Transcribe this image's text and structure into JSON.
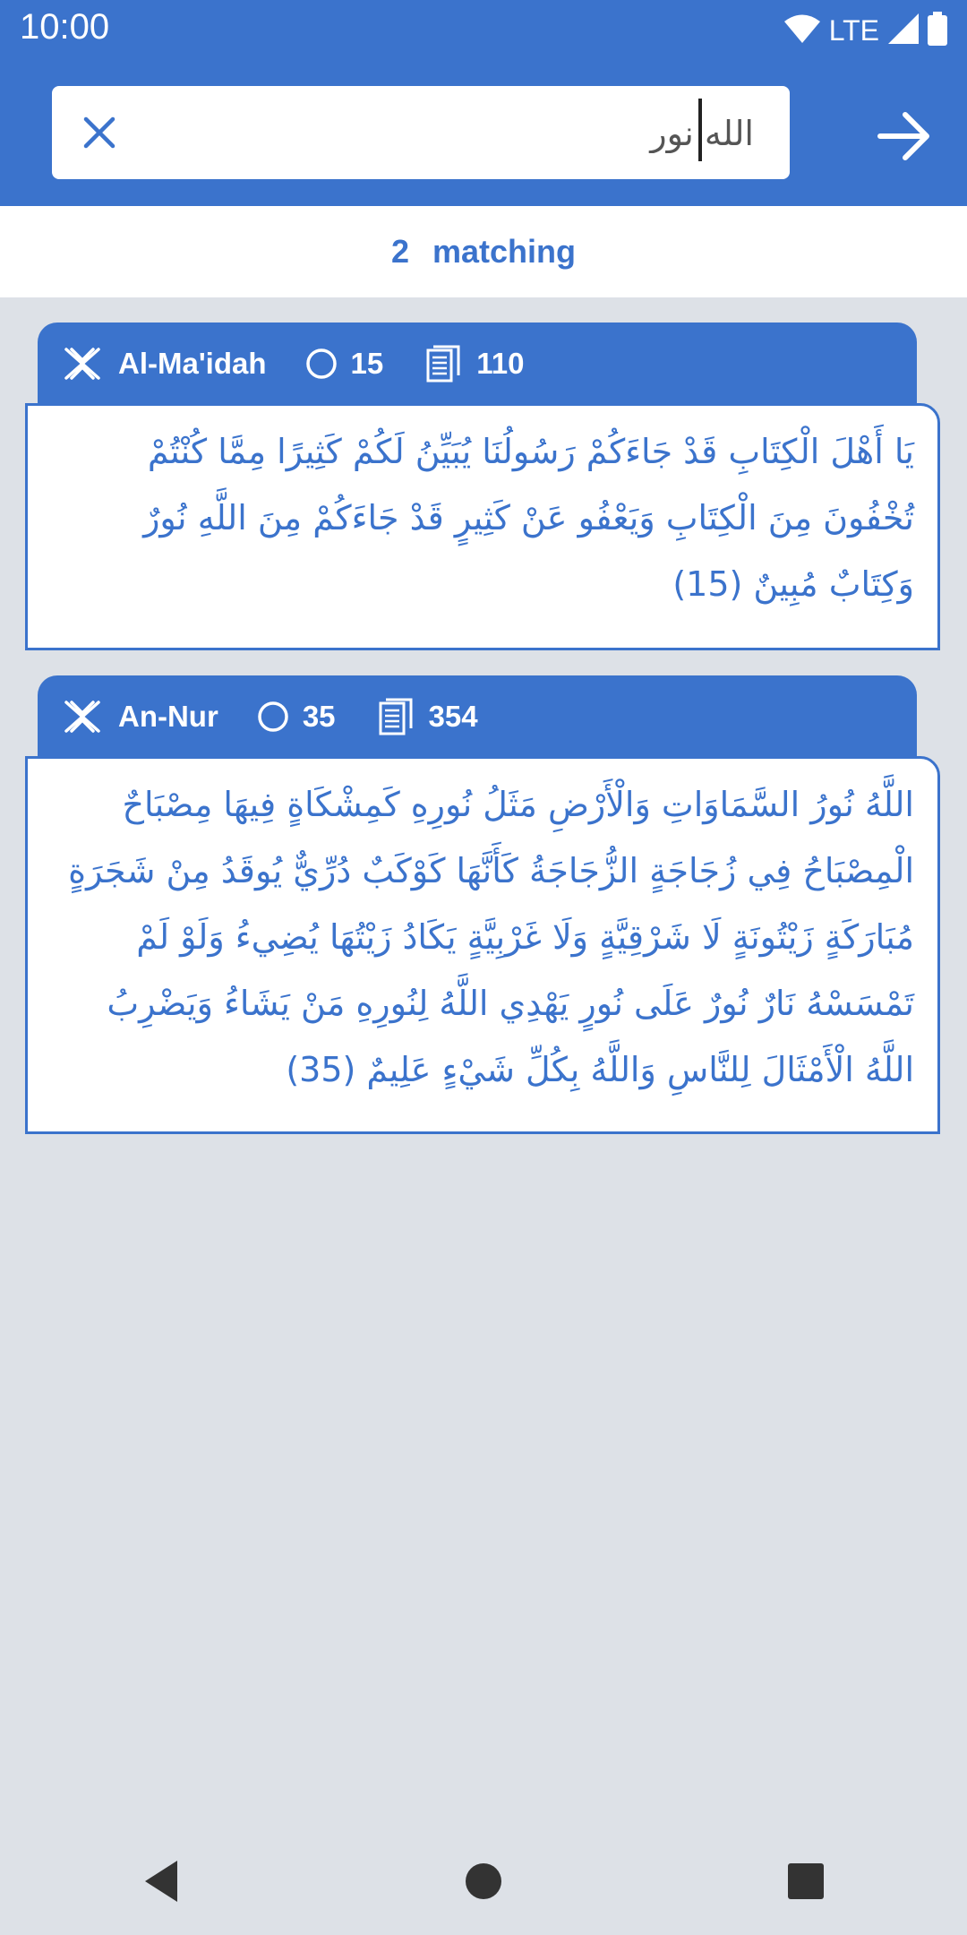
{
  "status_bar": {
    "time": "10:00",
    "network": "LTE"
  },
  "search": {
    "value": "الله نور",
    "placeholder": ""
  },
  "results": {
    "count": "2",
    "label": "matching"
  },
  "cards": [
    {
      "surah": "Al-Ma'idah",
      "ayah": "15",
      "page": "110",
      "text": "يَا أَهْلَ الْكِتَابِ قَدْ جَاءَكُمْ رَسُولُنَا يُبَيِّنُ لَكُمْ كَثِيرًا مِمَّا كُنْتُمْ تُخْفُونَ مِنَ الْكِتَابِ وَيَعْفُو عَنْ كَثِيرٍ قَدْ جَاءَكُمْ مِنَ اللَّهِ نُورٌ وَكِتَابٌ مُبِينٌ (15)"
    },
    {
      "surah": "An-Nur",
      "ayah": "35",
      "page": "354",
      "text": "اللَّهُ نُورُ السَّمَاوَاتِ وَالْأَرْضِ مَثَلُ نُورِهِ كَمِشْكَاةٍ فِيهَا مِصْبَاحٌ الْمِصْبَاحُ فِي زُجَاجَةٍ الزُّجَاجَةُ كَأَنَّهَا كَوْكَبٌ دُرِّيٌّ يُوقَدُ مِنْ شَجَرَةٍ مُبَارَكَةٍ زَيْتُونَةٍ لَا شَرْقِيَّةٍ وَلَا غَرْبِيَّةٍ يَكَادُ زَيْتُهَا يُضِيءُ وَلَوْ لَمْ تَمْسَسْهُ نَارٌ نُورٌ عَلَى نُورٍ يَهْدِي اللَّهُ لِنُورِهِ مَنْ يَشَاءُ وَيَضْرِبُ اللَّهُ الْأَمْثَالَ لِلنَّاسِ وَاللَّهُ بِكُلِّ شَيْءٍ عَلِيمٌ (35)"
    }
  ],
  "colors": {
    "primary": "#3b73cc",
    "background": "#dde1e7",
    "surface": "#ffffff"
  },
  "icons": {
    "clear": "close-icon",
    "submit": "arrow-right-icon",
    "surah": "quran-stand-icon",
    "ayah": "ayah-circle-icon",
    "page": "page-icon",
    "nav_back": "back-triangle-icon",
    "nav_home": "home-circle-icon",
    "nav_recents": "recents-square-icon"
  }
}
